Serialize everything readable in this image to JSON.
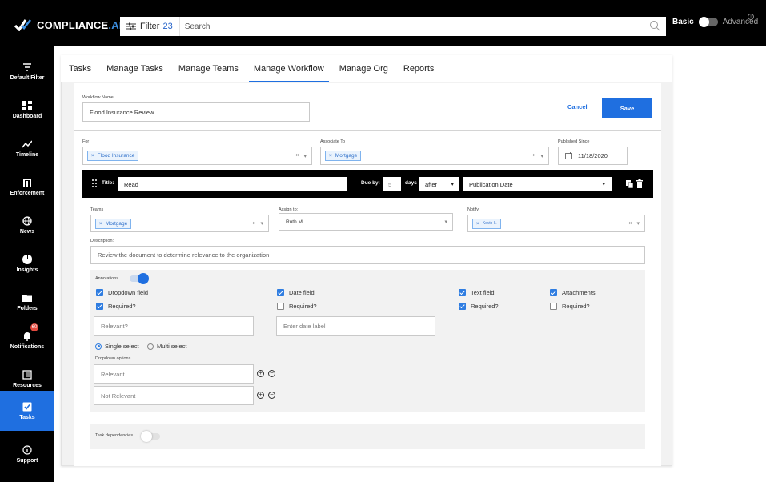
{
  "brand": {
    "name": "COMPLIANCE",
    "suffix": ".AI"
  },
  "topbar": {
    "filter_label": "Filter",
    "filter_count": "23",
    "search_placeholder": "Search",
    "mode_basic": "Basic",
    "mode_advanced": "Advanced"
  },
  "sidebar": {
    "items": [
      {
        "label": "Default Filter",
        "icon": "filter-icon"
      },
      {
        "label": "Dashboard",
        "icon": "dashboard-icon"
      },
      {
        "label": "Timeline",
        "icon": "timeline-icon"
      },
      {
        "label": "Enforcement",
        "icon": "gavel-icon"
      },
      {
        "label": "News",
        "icon": "globe-icon"
      },
      {
        "label": "Insights",
        "icon": "pie-chart-icon"
      },
      {
        "label": "Folders",
        "icon": "folder-icon"
      },
      {
        "label": "Notifications",
        "icon": "bell-icon",
        "badge": "60"
      },
      {
        "label": "Resources",
        "icon": "resources-icon"
      },
      {
        "label": "Tasks",
        "icon": "checkbox-icon",
        "active": true
      },
      {
        "label": "Support",
        "icon": "info-icon"
      }
    ]
  },
  "tabs": [
    "Tasks",
    "Manage Tasks",
    "Manage Teams",
    "Manage Workflow",
    "Manage Org",
    "Reports"
  ],
  "active_tab": "Manage Workflow",
  "workflow": {
    "name_label": "Workflow Name",
    "name_value": "Flood Insurance Review",
    "cancel_label": "Cancel",
    "save_label": "Save",
    "for_label": "For",
    "for_tag": "Flood Insurance",
    "associate_label": "Associate To",
    "associate_tag": "Mortgage",
    "published_label": "Published Since",
    "published_value": "11/18/2020"
  },
  "task": {
    "title_label": "Title:",
    "title_value": "Read",
    "due_label": "Due by:",
    "due_value": "5",
    "days_label": "days",
    "after_value": "after",
    "date_type_value": "Publication Date",
    "teams_label": "Teams",
    "teams_tag": "Mortgage",
    "assign_label": "Assign to:",
    "assign_value": "Ruth M.",
    "notify_label": "Notify:",
    "notify_tag": "Kevin k.",
    "description_label": "Description:",
    "description_value": "Review the document to determine relevance to the organization",
    "annotations_label": "Annotations",
    "dropdown_field": "Dropdown field",
    "date_field": "Date field",
    "text_field": "Text field",
    "attachments": "Attachments",
    "required": "Required?",
    "relevant_placeholder": "Relevant?",
    "date_label_placeholder": "Enter date label",
    "single_select": "Single select",
    "multi_select": "Multi select",
    "dropdown_options_label": "Dropdown options",
    "option_1": "Relevant",
    "option_2": "Not Relevant",
    "task_dependencies_label": "Task dependencies"
  }
}
